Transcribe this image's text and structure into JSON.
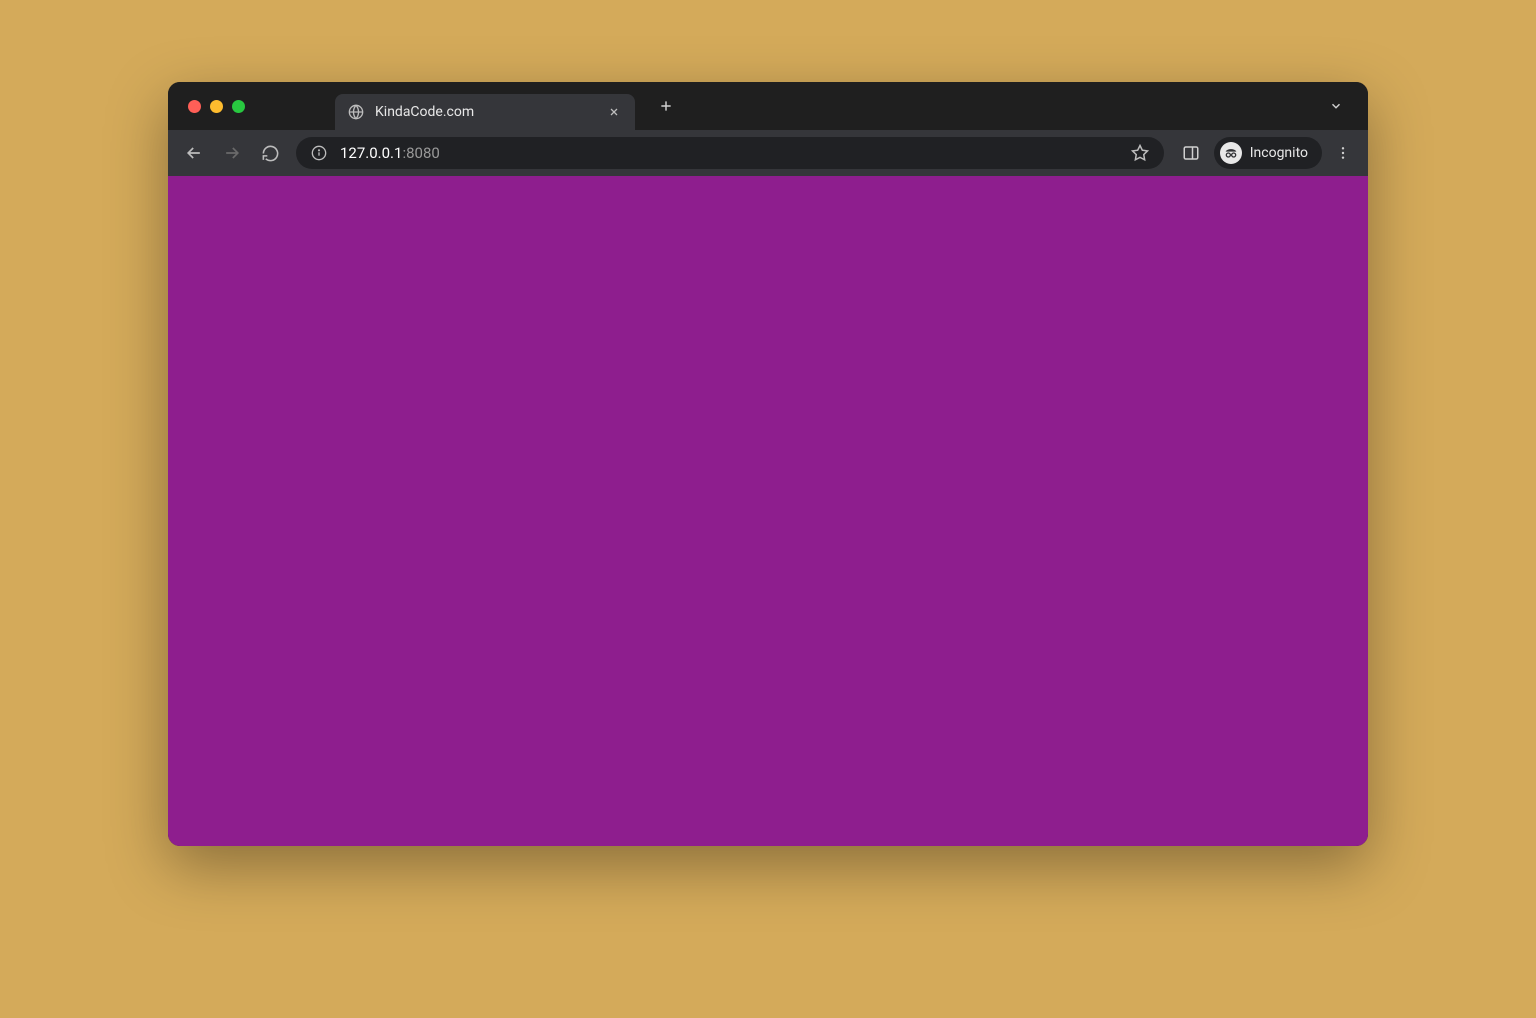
{
  "colors": {
    "desktop_bg": "#d4aa5a",
    "browser_chrome_dark": "#1f1f1f",
    "browser_toolbar": "#35363a",
    "address_bar_bg": "#202124",
    "page_bg": "#8e1e8e"
  },
  "traffic_lights": {
    "close": "close-window-dot",
    "minimize": "minimize-window-dot",
    "maximize": "maximize-window-dot"
  },
  "tab": {
    "title": "KindaCode.com",
    "favicon": "globe-icon"
  },
  "toolbar": {
    "nav": {
      "back_icon": "back-icon",
      "forward_icon": "forward-icon",
      "reload_icon": "reload-icon"
    },
    "address": {
      "site_info_icon": "info-icon",
      "host": "127.0.0.1",
      "port": ":8080",
      "bookmark_icon": "star-icon"
    },
    "side_panel_icon": "side-panel-icon",
    "incognito": {
      "icon": "incognito-icon",
      "label": "Incognito"
    },
    "menu_icon": "kebab-menu-icon",
    "tabs_dropdown_icon": "chevron-down-icon",
    "new_tab_icon": "plus-icon"
  }
}
